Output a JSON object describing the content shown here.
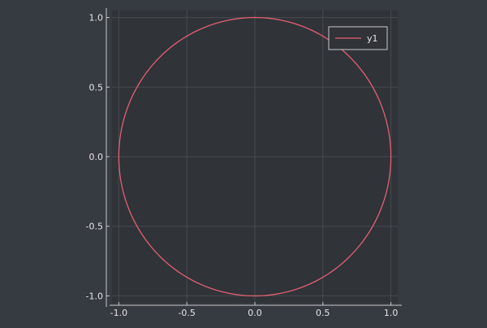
{
  "chart_data": {
    "type": "line",
    "title": "",
    "xlabel": "",
    "ylabel": "",
    "xlim": [
      -1.05,
      1.05
    ],
    "ylim": [
      -1.05,
      1.05
    ],
    "xticks": [
      -1.0,
      -0.5,
      0.0,
      0.5,
      1.0
    ],
    "yticks": [
      -1.0,
      -0.5,
      0.0,
      0.5,
      1.0
    ],
    "xtick_labels": [
      "-1.0",
      "-0.5",
      "0.0",
      "0.5",
      "1.0"
    ],
    "ytick_labels": [
      "-1.0",
      "-0.5",
      "0.0",
      "0.5",
      "1.0"
    ],
    "grid": true,
    "aspect_ratio": "equal",
    "legend": {
      "position": "top-right",
      "entries": [
        "y1"
      ]
    },
    "series": [
      {
        "name": "y1",
        "color": "#e26171",
        "shape": "unit circle",
        "x": [
          1.0,
          0.866,
          0.5,
          0.0,
          -0.5,
          -0.866,
          -1.0,
          -0.866,
          -0.5,
          0.0,
          0.5,
          0.866,
          1.0
        ],
        "y": [
          0.0,
          0.5,
          0.866,
          1.0,
          0.866,
          0.5,
          0.0,
          -0.5,
          -0.866,
          -1.0,
          -0.866,
          -0.5,
          0.0
        ]
      }
    ],
    "colors": {
      "background": "#363a41",
      "plot_area": "#303338",
      "grid": "#474b52",
      "axis": "#c8c8c8",
      "text": "#e6e6e6",
      "legend_border": "#c8c8c8"
    }
  }
}
